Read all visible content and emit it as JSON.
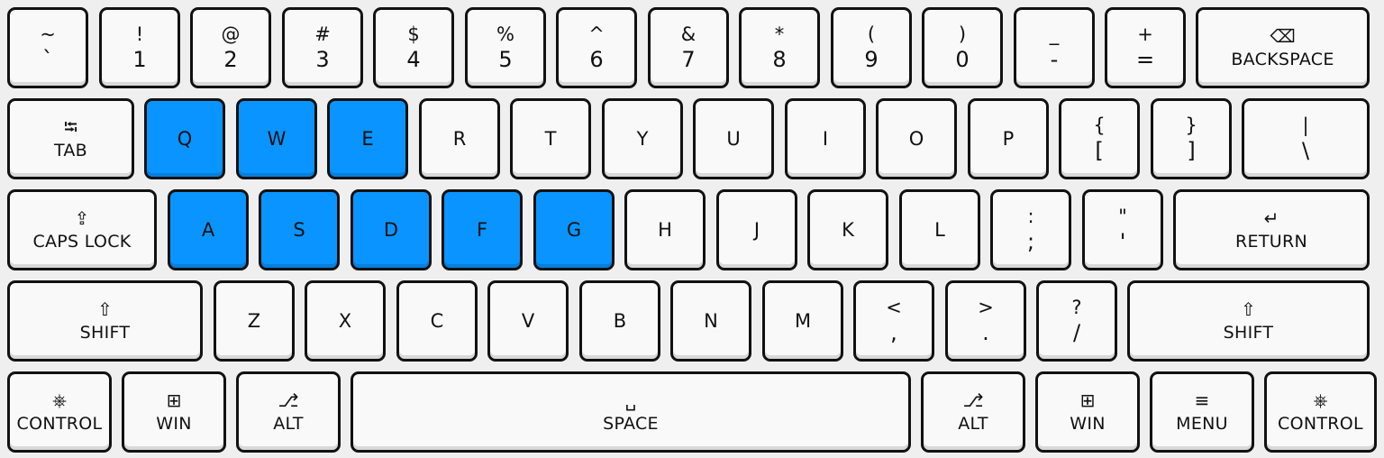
{
  "highlight_color": "#0a94ff",
  "rows": [
    [
      {
        "top": "~",
        "bottom": "`"
      },
      {
        "top": "!",
        "bottom": "1"
      },
      {
        "top": "@",
        "bottom": "2"
      },
      {
        "top": "#",
        "bottom": "3"
      },
      {
        "top": "$",
        "bottom": "4"
      },
      {
        "top": "%",
        "bottom": "5"
      },
      {
        "top": "^",
        "bottom": "6"
      },
      {
        "top": "&",
        "bottom": "7"
      },
      {
        "top": "*",
        "bottom": "8"
      },
      {
        "top": "(",
        "bottom": "9"
      },
      {
        "top": ")",
        "bottom": "0"
      },
      {
        "top": "_",
        "bottom": "-"
      },
      {
        "top": "+",
        "bottom": "="
      },
      {
        "icon": "⌫",
        "icon_name": "backspace-icon",
        "label": "BACKSPACE"
      }
    ],
    [
      {
        "icon": "⭾",
        "icon_name": "tab-icon",
        "label": "TAB"
      },
      {
        "label": "Q",
        "highlight": true
      },
      {
        "label": "W",
        "highlight": true
      },
      {
        "label": "E",
        "highlight": true
      },
      {
        "label": "R"
      },
      {
        "label": "T"
      },
      {
        "label": "Y"
      },
      {
        "label": "U"
      },
      {
        "label": "I"
      },
      {
        "label": "O"
      },
      {
        "label": "P"
      },
      {
        "top": "{",
        "bottom": "["
      },
      {
        "top": "}",
        "bottom": "]"
      },
      {
        "top": "|",
        "bottom": "\\"
      }
    ],
    [
      {
        "icon": "⇪",
        "icon_name": "caps-lock-icon",
        "label": "CAPS LOCK"
      },
      {
        "label": "A",
        "highlight": true
      },
      {
        "label": "S",
        "highlight": true
      },
      {
        "label": "D",
        "highlight": true
      },
      {
        "label": "F",
        "highlight": true
      },
      {
        "label": "G",
        "highlight": true
      },
      {
        "label": "H"
      },
      {
        "label": "J"
      },
      {
        "label": "K"
      },
      {
        "label": "L"
      },
      {
        "top": ":",
        "bottom": ";"
      },
      {
        "top": "\"",
        "bottom": "'"
      },
      {
        "icon": "↵",
        "icon_name": "return-icon",
        "label": "RETURN"
      }
    ],
    [
      {
        "icon": "⇧",
        "icon_name": "shift-icon",
        "label": "SHIFT"
      },
      {
        "label": "Z"
      },
      {
        "label": "X"
      },
      {
        "label": "C"
      },
      {
        "label": "V"
      },
      {
        "label": "B"
      },
      {
        "label": "N"
      },
      {
        "label": "M"
      },
      {
        "top": "<",
        "bottom": ","
      },
      {
        "top": ">",
        "bottom": "."
      },
      {
        "top": "?",
        "bottom": "/"
      },
      {
        "icon": "⇧",
        "icon_name": "shift-icon",
        "label": "SHIFT"
      }
    ],
    [
      {
        "icon": "⎈",
        "icon_name": "control-icon",
        "label": "CONTROL"
      },
      {
        "icon": "⊞",
        "icon_name": "windows-icon",
        "label": "WIN"
      },
      {
        "icon": "⎇",
        "icon_name": "alt-icon",
        "label": "ALT"
      },
      {
        "icon": "␣",
        "icon_name": "space-icon",
        "label": "SPACE"
      },
      {
        "icon": "⎇",
        "icon_name": "alt-icon",
        "label": "ALT"
      },
      {
        "icon": "⊞",
        "icon_name": "windows-icon",
        "label": "WIN"
      },
      {
        "icon": "≡",
        "icon_name": "menu-icon",
        "label": "MENU"
      },
      {
        "icon": "⎈",
        "icon_name": "control-icon",
        "label": "CONTROL"
      }
    ]
  ]
}
